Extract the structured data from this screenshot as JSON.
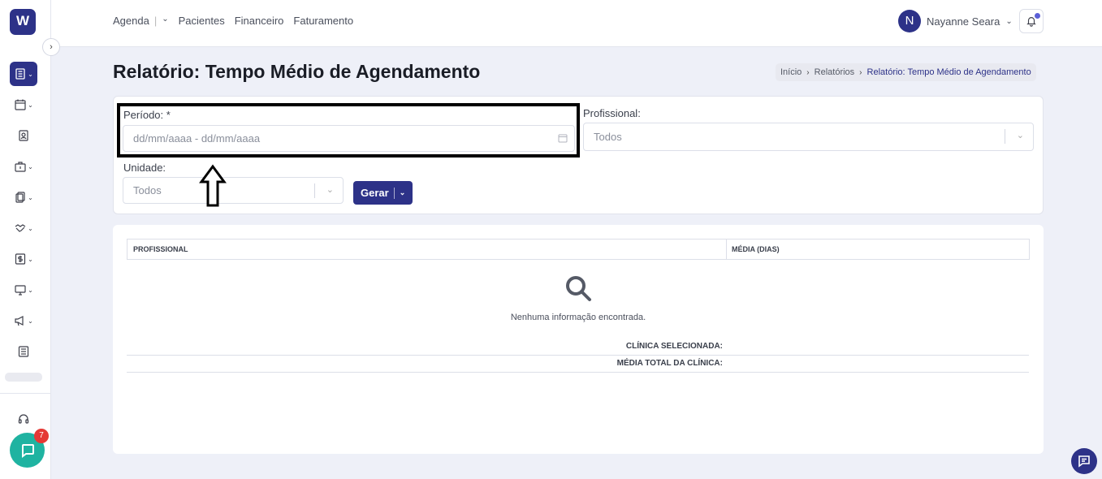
{
  "sidebar": {
    "logo": "W",
    "chat_badge": "7"
  },
  "topnav": {
    "agenda": "Agenda",
    "pacientes": "Pacientes",
    "financeiro": "Financeiro",
    "faturamento": "Faturamento"
  },
  "user": {
    "initial": "N",
    "name": "Nayanne Seara"
  },
  "page": {
    "title": "Relatório: Tempo Médio de Agendamento"
  },
  "breadcrumb": {
    "home": "Início",
    "reports": "Relatórios",
    "current": "Relatório: Tempo Médio de Agendamento"
  },
  "filters": {
    "periodo_label": "Período: *",
    "periodo_placeholder": "dd/mm/aaaa - dd/mm/aaaa",
    "profissional_label": "Profissional:",
    "profissional_value": "Todos",
    "unidade_label": "Unidade:",
    "unidade_value": "Todos",
    "gerar_label": "Gerar"
  },
  "table": {
    "columns": [
      "PROFISSIONAL",
      "MÉDIA (DIAS)"
    ],
    "empty_message": "Nenhuma informação encontrada."
  },
  "summary": {
    "clinica": "CLÍNICA SELECIONADA:",
    "media_total": "MÉDIA TOTAL DA CLÍNICA:"
  },
  "colors": {
    "primary": "#2d3288",
    "chat": "#1fb3a1",
    "badge": "#e53935"
  }
}
